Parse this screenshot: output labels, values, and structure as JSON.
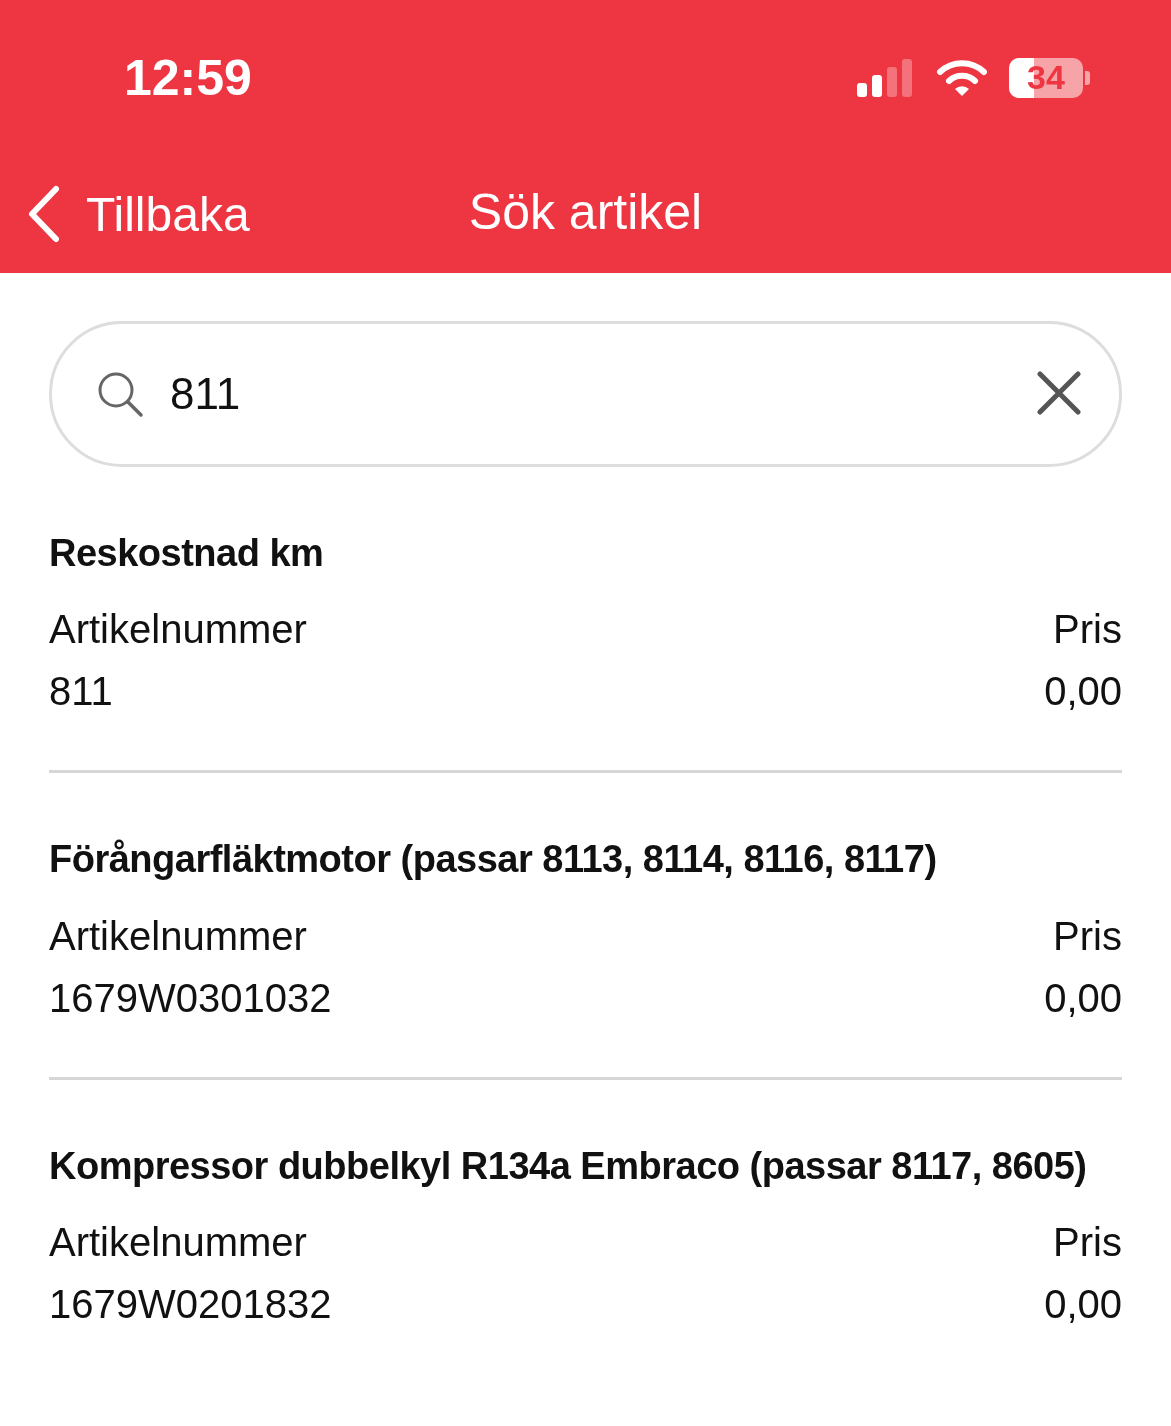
{
  "status_bar": {
    "time": "12:59",
    "battery": "34"
  },
  "nav": {
    "back": "Tillbaka",
    "title": "Sök artikel"
  },
  "search": {
    "value": "811"
  },
  "results": [
    {
      "name": "Reskostnad km",
      "number_label": "Artikelnummer",
      "number": "811",
      "price_label": "Pris",
      "price": "0,00"
    },
    {
      "name": "Förångarfläktmotor (passar 8113, 8114, 8116, 8117)",
      "number_label": "Artikelnummer",
      "number": "1679W0301032",
      "price_label": "Pris",
      "price": "0,00"
    },
    {
      "name": "Kompressor dubbelkyl R134a Embraco (passar 8117, 8605)",
      "number_label": "Artikelnummer",
      "number": "1679W0201832",
      "price_label": "Pris",
      "price": "0,00"
    }
  ]
}
